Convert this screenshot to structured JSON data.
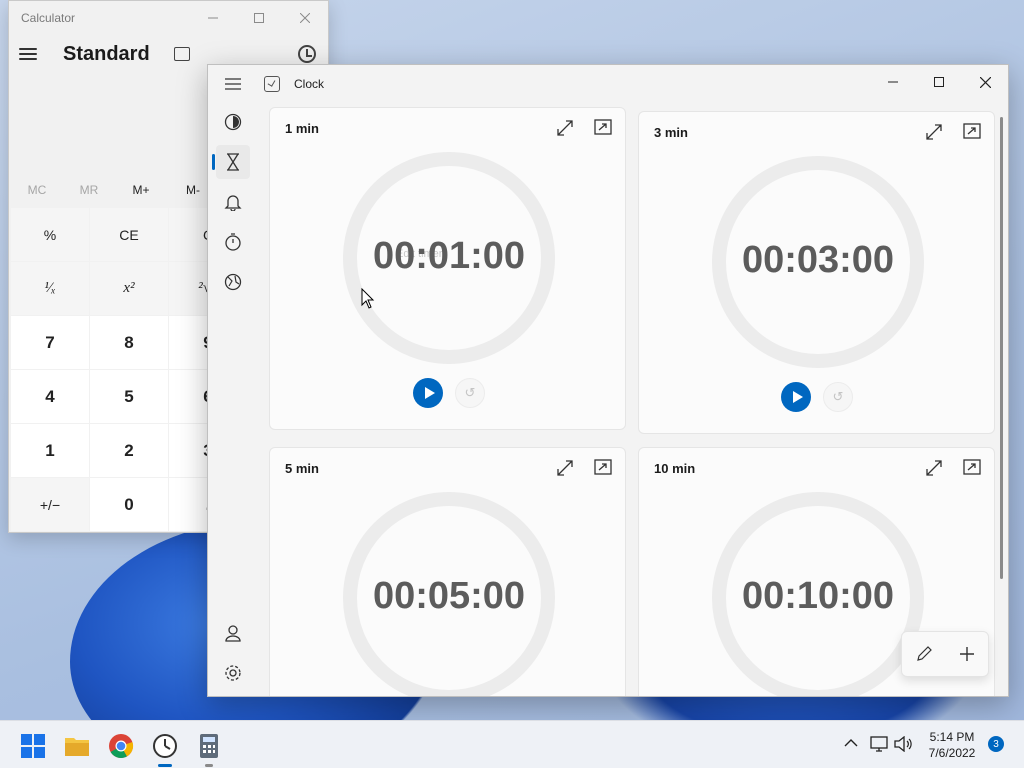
{
  "calculator": {
    "window_title": "Calculator",
    "mode": "Standard",
    "memory": [
      "MC",
      "MR",
      "M+",
      "M-"
    ],
    "keys": [
      [
        "%",
        "CE",
        "C",
        "⌫"
      ],
      [
        "¹⁄ₓ",
        "x²",
        "²√x",
        "÷"
      ],
      [
        "7",
        "8",
        "9",
        "×"
      ],
      [
        "4",
        "5",
        "6",
        "−"
      ],
      [
        "1",
        "2",
        "3",
        "+"
      ],
      [
        "+/−",
        "0",
        ".",
        "="
      ]
    ]
  },
  "clock": {
    "window_title": "Clock",
    "nav": [
      "focus-sessions-icon",
      "timer-icon",
      "alarm-icon",
      "stopwatch-icon",
      "world-clock-icon"
    ],
    "timers": [
      {
        "name": "1 min",
        "time": "00:01:00"
      },
      {
        "name": "3 min",
        "time": "00:03:00"
      },
      {
        "name": "5 min",
        "time": "00:05:00"
      },
      {
        "name": "10 min",
        "time": "00:10:00"
      }
    ],
    "edit_hint": "Edit timer",
    "accent_color": "#0067c0"
  },
  "taskbar": {
    "apps": [
      "start-icon",
      "file-explorer-icon",
      "chrome-icon",
      "clock-app-icon",
      "calculator-app-icon"
    ],
    "time": "5:14 PM",
    "date": "7/6/2022",
    "notification_count": "3"
  }
}
